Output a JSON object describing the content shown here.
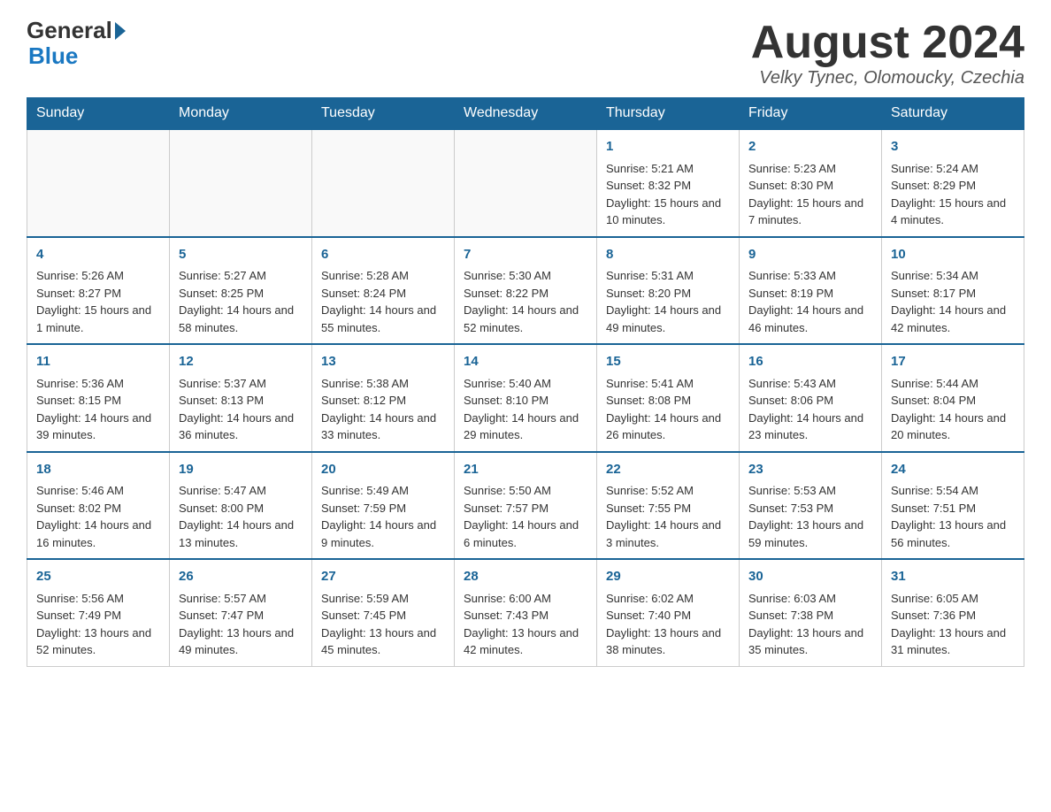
{
  "header": {
    "logo_general": "General",
    "logo_blue": "Blue",
    "month_title": "August 2024",
    "location": "Velky Tynec, Olomoucky, Czechia"
  },
  "days_of_week": [
    "Sunday",
    "Monday",
    "Tuesday",
    "Wednesday",
    "Thursday",
    "Friday",
    "Saturday"
  ],
  "weeks": [
    [
      {
        "day": "",
        "sunrise": "",
        "sunset": "",
        "daylight": ""
      },
      {
        "day": "",
        "sunrise": "",
        "sunset": "",
        "daylight": ""
      },
      {
        "day": "",
        "sunrise": "",
        "sunset": "",
        "daylight": ""
      },
      {
        "day": "",
        "sunrise": "",
        "sunset": "",
        "daylight": ""
      },
      {
        "day": "1",
        "sunrise": "Sunrise: 5:21 AM",
        "sunset": "Sunset: 8:32 PM",
        "daylight": "Daylight: 15 hours and 10 minutes."
      },
      {
        "day": "2",
        "sunrise": "Sunrise: 5:23 AM",
        "sunset": "Sunset: 8:30 PM",
        "daylight": "Daylight: 15 hours and 7 minutes."
      },
      {
        "day": "3",
        "sunrise": "Sunrise: 5:24 AM",
        "sunset": "Sunset: 8:29 PM",
        "daylight": "Daylight: 15 hours and 4 minutes."
      }
    ],
    [
      {
        "day": "4",
        "sunrise": "Sunrise: 5:26 AM",
        "sunset": "Sunset: 8:27 PM",
        "daylight": "Daylight: 15 hours and 1 minute."
      },
      {
        "day": "5",
        "sunrise": "Sunrise: 5:27 AM",
        "sunset": "Sunset: 8:25 PM",
        "daylight": "Daylight: 14 hours and 58 minutes."
      },
      {
        "day": "6",
        "sunrise": "Sunrise: 5:28 AM",
        "sunset": "Sunset: 8:24 PM",
        "daylight": "Daylight: 14 hours and 55 minutes."
      },
      {
        "day": "7",
        "sunrise": "Sunrise: 5:30 AM",
        "sunset": "Sunset: 8:22 PM",
        "daylight": "Daylight: 14 hours and 52 minutes."
      },
      {
        "day": "8",
        "sunrise": "Sunrise: 5:31 AM",
        "sunset": "Sunset: 8:20 PM",
        "daylight": "Daylight: 14 hours and 49 minutes."
      },
      {
        "day": "9",
        "sunrise": "Sunrise: 5:33 AM",
        "sunset": "Sunset: 8:19 PM",
        "daylight": "Daylight: 14 hours and 46 minutes."
      },
      {
        "day": "10",
        "sunrise": "Sunrise: 5:34 AM",
        "sunset": "Sunset: 8:17 PM",
        "daylight": "Daylight: 14 hours and 42 minutes."
      }
    ],
    [
      {
        "day": "11",
        "sunrise": "Sunrise: 5:36 AM",
        "sunset": "Sunset: 8:15 PM",
        "daylight": "Daylight: 14 hours and 39 minutes."
      },
      {
        "day": "12",
        "sunrise": "Sunrise: 5:37 AM",
        "sunset": "Sunset: 8:13 PM",
        "daylight": "Daylight: 14 hours and 36 minutes."
      },
      {
        "day": "13",
        "sunrise": "Sunrise: 5:38 AM",
        "sunset": "Sunset: 8:12 PM",
        "daylight": "Daylight: 14 hours and 33 minutes."
      },
      {
        "day": "14",
        "sunrise": "Sunrise: 5:40 AM",
        "sunset": "Sunset: 8:10 PM",
        "daylight": "Daylight: 14 hours and 29 minutes."
      },
      {
        "day": "15",
        "sunrise": "Sunrise: 5:41 AM",
        "sunset": "Sunset: 8:08 PM",
        "daylight": "Daylight: 14 hours and 26 minutes."
      },
      {
        "day": "16",
        "sunrise": "Sunrise: 5:43 AM",
        "sunset": "Sunset: 8:06 PM",
        "daylight": "Daylight: 14 hours and 23 minutes."
      },
      {
        "day": "17",
        "sunrise": "Sunrise: 5:44 AM",
        "sunset": "Sunset: 8:04 PM",
        "daylight": "Daylight: 14 hours and 20 minutes."
      }
    ],
    [
      {
        "day": "18",
        "sunrise": "Sunrise: 5:46 AM",
        "sunset": "Sunset: 8:02 PM",
        "daylight": "Daylight: 14 hours and 16 minutes."
      },
      {
        "day": "19",
        "sunrise": "Sunrise: 5:47 AM",
        "sunset": "Sunset: 8:00 PM",
        "daylight": "Daylight: 14 hours and 13 minutes."
      },
      {
        "day": "20",
        "sunrise": "Sunrise: 5:49 AM",
        "sunset": "Sunset: 7:59 PM",
        "daylight": "Daylight: 14 hours and 9 minutes."
      },
      {
        "day": "21",
        "sunrise": "Sunrise: 5:50 AM",
        "sunset": "Sunset: 7:57 PM",
        "daylight": "Daylight: 14 hours and 6 minutes."
      },
      {
        "day": "22",
        "sunrise": "Sunrise: 5:52 AM",
        "sunset": "Sunset: 7:55 PM",
        "daylight": "Daylight: 14 hours and 3 minutes."
      },
      {
        "day": "23",
        "sunrise": "Sunrise: 5:53 AM",
        "sunset": "Sunset: 7:53 PM",
        "daylight": "Daylight: 13 hours and 59 minutes."
      },
      {
        "day": "24",
        "sunrise": "Sunrise: 5:54 AM",
        "sunset": "Sunset: 7:51 PM",
        "daylight": "Daylight: 13 hours and 56 minutes."
      }
    ],
    [
      {
        "day": "25",
        "sunrise": "Sunrise: 5:56 AM",
        "sunset": "Sunset: 7:49 PM",
        "daylight": "Daylight: 13 hours and 52 minutes."
      },
      {
        "day": "26",
        "sunrise": "Sunrise: 5:57 AM",
        "sunset": "Sunset: 7:47 PM",
        "daylight": "Daylight: 13 hours and 49 minutes."
      },
      {
        "day": "27",
        "sunrise": "Sunrise: 5:59 AM",
        "sunset": "Sunset: 7:45 PM",
        "daylight": "Daylight: 13 hours and 45 minutes."
      },
      {
        "day": "28",
        "sunrise": "Sunrise: 6:00 AM",
        "sunset": "Sunset: 7:43 PM",
        "daylight": "Daylight: 13 hours and 42 minutes."
      },
      {
        "day": "29",
        "sunrise": "Sunrise: 6:02 AM",
        "sunset": "Sunset: 7:40 PM",
        "daylight": "Daylight: 13 hours and 38 minutes."
      },
      {
        "day": "30",
        "sunrise": "Sunrise: 6:03 AM",
        "sunset": "Sunset: 7:38 PM",
        "daylight": "Daylight: 13 hours and 35 minutes."
      },
      {
        "day": "31",
        "sunrise": "Sunrise: 6:05 AM",
        "sunset": "Sunset: 7:36 PM",
        "daylight": "Daylight: 13 hours and 31 minutes."
      }
    ]
  ]
}
